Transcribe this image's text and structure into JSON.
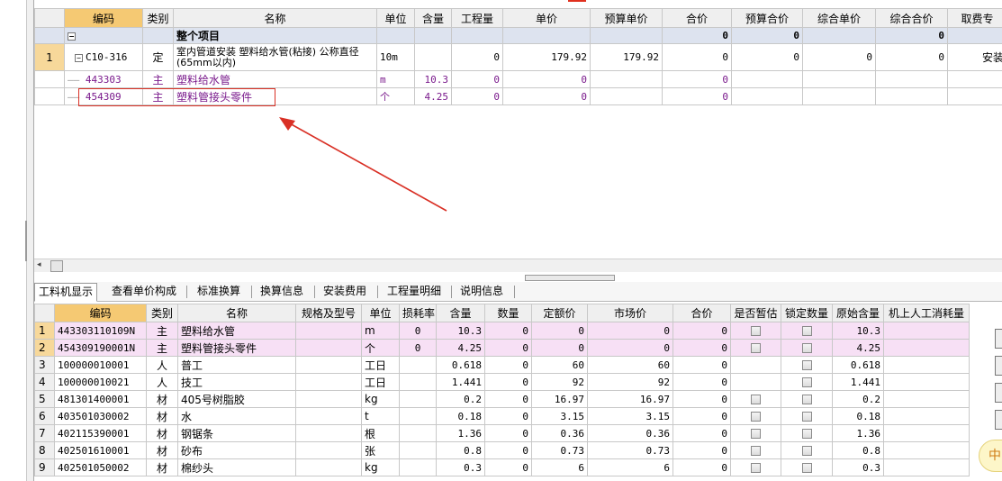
{
  "top": {
    "headers": [
      "编码",
      "类别",
      "名称",
      "单位",
      "含量",
      "工程量",
      "单价",
      "预算单价",
      "合价",
      "预算合价",
      "综合单价",
      "综合合价",
      "取费专"
    ],
    "whole_row": {
      "label": "整个项目",
      "hejia": "0",
      "ys_hejia": "0",
      "zh_hejia": "0"
    },
    "item_row": {
      "rowno": "1",
      "code": "C10-316",
      "type": "定",
      "name": "室内管道安装 塑料给水管(粘接) 公称直径(65mm以内)",
      "unit": "10m",
      "qty": "0",
      "price": "179.92",
      "ys_price": "179.92",
      "hejia": "0",
      "ys_hejia": "0",
      "zh_price": "0",
      "zh_hejia": "0",
      "fee": "安装"
    },
    "sub_rows": [
      {
        "code": "443303",
        "type": "主",
        "name": "塑料给水管",
        "unit": "m",
        "content": "10.3",
        "qty": "0",
        "price": "0",
        "hejia": "0"
      },
      {
        "code": "454309",
        "type": "主",
        "name": "塑料管接头零件",
        "unit": "个",
        "content": "4.25",
        "qty": "0",
        "price": "0",
        "hejia": "0"
      }
    ]
  },
  "tabs": [
    "工料机显示",
    "查看单价构成",
    "标准换算",
    "换算信息",
    "安装费用",
    "工程量明细",
    "说明信息"
  ],
  "bottom": {
    "headers": [
      "编码",
      "类别",
      "名称",
      "规格及型号",
      "单位",
      "损耗率",
      "含量",
      "数量",
      "定额价",
      "市场价",
      "合价",
      "是否暂估",
      "锁定数量",
      "原始含量",
      "机上人工消耗量"
    ],
    "rows": [
      {
        "no": "1",
        "code": "443303110109N",
        "type": "主",
        "name": "塑料给水管",
        "unit": "m",
        "loss": "0",
        "content": "10.3",
        "qty": "0",
        "quota": "0",
        "market": "0",
        "hejia": "0",
        "orig": "10.3"
      },
      {
        "no": "2",
        "code": "454309190001N",
        "type": "主",
        "name": "塑料管接头零件",
        "unit": "个",
        "loss": "0",
        "content": "4.25",
        "qty": "0",
        "quota": "0",
        "market": "0",
        "hejia": "0",
        "orig": "4.25"
      },
      {
        "no": "3",
        "code": "100000010001",
        "type": "人",
        "name": "普工",
        "unit": "工日",
        "loss": "",
        "content": "0.618",
        "qty": "0",
        "quota": "60",
        "market": "60",
        "hejia": "0",
        "orig": "0.618"
      },
      {
        "no": "4",
        "code": "100000010021",
        "type": "人",
        "name": "技工",
        "unit": "工日",
        "loss": "",
        "content": "1.441",
        "qty": "0",
        "quota": "92",
        "market": "92",
        "hejia": "0",
        "orig": "1.441"
      },
      {
        "no": "5",
        "code": "481301400001",
        "type": "材",
        "name": "405号树脂胶",
        "unit": "kg",
        "loss": "",
        "content": "0.2",
        "qty": "0",
        "quota": "16.97",
        "market": "16.97",
        "hejia": "0",
        "orig": "0.2"
      },
      {
        "no": "6",
        "code": "403501030002",
        "type": "材",
        "name": "水",
        "unit": "t",
        "loss": "",
        "content": "0.18",
        "qty": "0",
        "quota": "3.15",
        "market": "3.15",
        "hejia": "0",
        "orig": "0.18"
      },
      {
        "no": "7",
        "code": "402115390001",
        "type": "材",
        "name": "钢锯条",
        "unit": "根",
        "loss": "",
        "content": "1.36",
        "qty": "0",
        "quota": "0.36",
        "market": "0.36",
        "hejia": "0",
        "orig": "1.36"
      },
      {
        "no": "8",
        "code": "402501610001",
        "type": "材",
        "name": "砂布",
        "unit": "张",
        "loss": "",
        "content": "0.8",
        "qty": "0",
        "quota": "0.73",
        "market": "0.73",
        "hejia": "0",
        "orig": "0.8"
      },
      {
        "no": "9",
        "code": "402501050002",
        "type": "材",
        "name": "棉纱头",
        "unit": "kg",
        "loss": "",
        "content": "0.3",
        "qty": "0",
        "quota": "6",
        "market": "6",
        "hejia": "0",
        "orig": "0.3"
      }
    ]
  },
  "ime": {
    "label": "中"
  },
  "colors": {
    "header_code": "#f5c973",
    "annotation": "#d93025",
    "whole_row": "#dde3ef",
    "pink_row": "#f7e0f5"
  }
}
